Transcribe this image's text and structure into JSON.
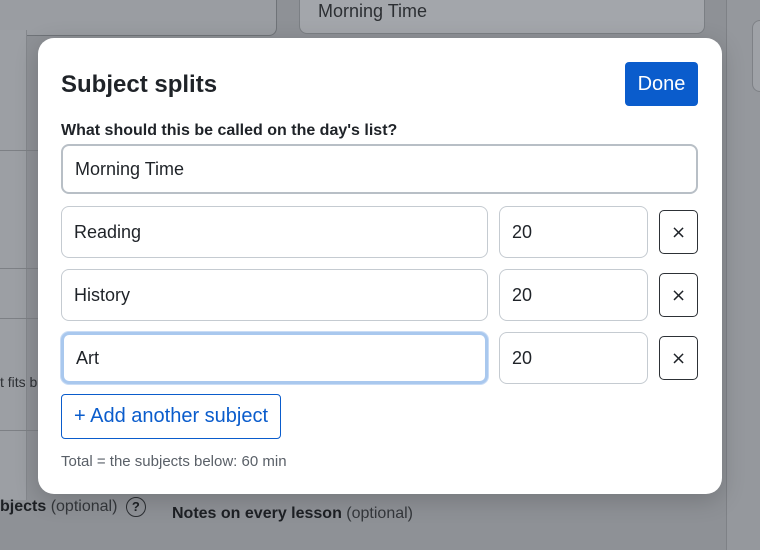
{
  "background": {
    "top_input_value": "Morning Time",
    "partial_text": "t fits b",
    "subjects_label": "bjects",
    "subjects_optional": "(optional)",
    "help_icon_glyph": "?",
    "notes_label": "Notes on every lesson",
    "notes_optional": "(optional)"
  },
  "modal": {
    "title": "Subject splits",
    "done_label": "Done",
    "list_name_label": "What should this be called on the day's list?",
    "list_name_value": "Morning Time",
    "rows": [
      {
        "subject": "Reading",
        "minutes": "20",
        "remove_label": "×"
      },
      {
        "subject": "History",
        "minutes": "20",
        "remove_label": "×"
      },
      {
        "subject": "Art",
        "minutes": "20",
        "remove_label": "×"
      }
    ],
    "add_label": "+ Add another subject",
    "total_text": "Total = the subjects below: 60 min"
  },
  "colors": {
    "accent": "#0a5ccc",
    "focus_ring": "#a9c8ee",
    "overlay": "#8e9196"
  },
  "icons": {
    "remove": "close-icon",
    "help": "help-icon"
  }
}
